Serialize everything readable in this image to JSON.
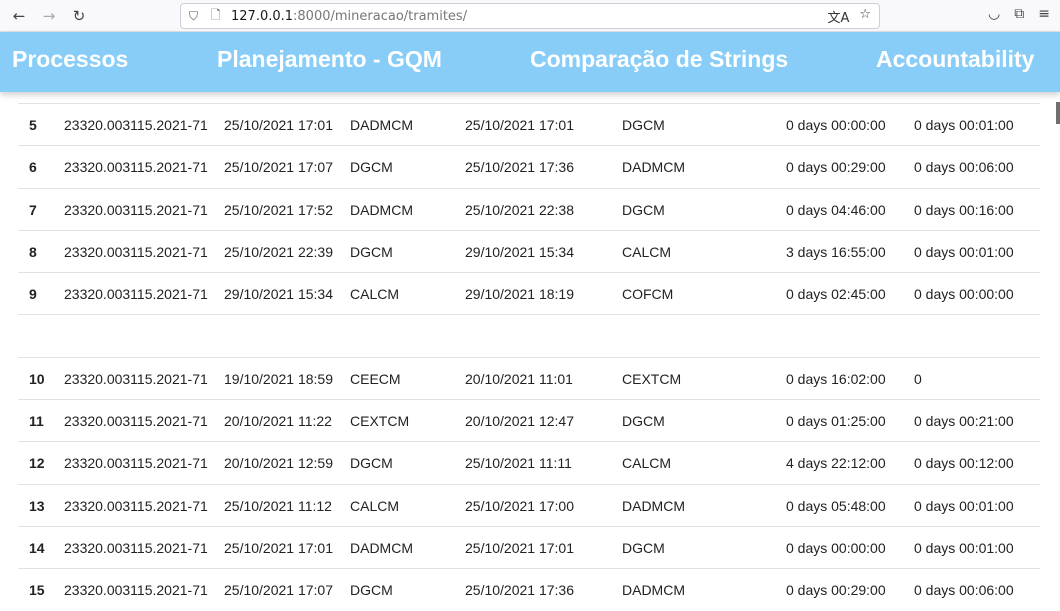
{
  "browser": {
    "back_icon": "←",
    "forward_icon": "→",
    "reload_icon": "↻",
    "url_host": "127.0.0.1",
    "url_path": ":8000/mineracao/tramites/",
    "translate_icon": "文A",
    "bookmark_icon": "☆",
    "pocket_icon": "◡",
    "extensions_icon": "⧉",
    "menu_icon": "≡"
  },
  "nav": {
    "items": [
      "Processos",
      "Planejamento - GQM",
      "Comparação de Strings",
      "Accountability"
    ]
  },
  "table": {
    "rows": [
      {
        "id": "5",
        "processo": "23320.003115.2021-71",
        "data_inicio": "25/10/2021 17:01",
        "origem": "DADMCM",
        "data_fim": "25/10/2021 17:01",
        "destino": "DGCM",
        "tempo": "0 days 00:00:00",
        "tempo2": "0 days 00:01:00"
      },
      {
        "id": "6",
        "processo": "23320.003115.2021-71",
        "data_inicio": "25/10/2021 17:07",
        "origem": "DGCM",
        "data_fim": "25/10/2021 17:36",
        "destino": "DADMCM",
        "tempo": "0 days 00:29:00",
        "tempo2": "0 days 00:06:00"
      },
      {
        "id": "7",
        "processo": "23320.003115.2021-71",
        "data_inicio": "25/10/2021 17:52",
        "origem": "DADMCM",
        "data_fim": "25/10/2021 22:38",
        "destino": "DGCM",
        "tempo": "0 days 04:46:00",
        "tempo2": "0 days 00:16:00"
      },
      {
        "id": "8",
        "processo": "23320.003115.2021-71",
        "data_inicio": "25/10/2021 22:39",
        "origem": "DGCM",
        "data_fim": "29/10/2021 15:34",
        "destino": "CALCM",
        "tempo": "3 days 16:55:00",
        "tempo2": "0 days 00:01:00"
      },
      {
        "id": "9",
        "processo": "23320.003115.2021-71",
        "data_inicio": "29/10/2021 15:34",
        "origem": "CALCM",
        "data_fim": "29/10/2021 18:19",
        "destino": "COFCM",
        "tempo": "0 days 02:45:00",
        "tempo2": "0 days 00:00:00"
      },
      {
        "blank": true
      },
      {
        "id": "10",
        "processo": "23320.003115.2021-71",
        "data_inicio": "19/10/2021 18:59",
        "origem": "CEECM",
        "data_fim": "20/10/2021 11:01",
        "destino": "CEXTCM",
        "tempo": "0 days 16:02:00",
        "tempo2": "0"
      },
      {
        "id": "11",
        "processo": "23320.003115.2021-71",
        "data_inicio": "20/10/2021 11:22",
        "origem": "CEXTCM",
        "data_fim": "20/10/2021 12:47",
        "destino": "DGCM",
        "tempo": "0 days 01:25:00",
        "tempo2": "0 days 00:21:00"
      },
      {
        "id": "12",
        "processo": "23320.003115.2021-71",
        "data_inicio": "20/10/2021 12:59",
        "origem": "DGCM",
        "data_fim": "25/10/2021 11:11",
        "destino": "CALCM",
        "tempo": "4 days 22:12:00",
        "tempo2": "0 days 00:12:00"
      },
      {
        "id": "13",
        "processo": "23320.003115.2021-71",
        "data_inicio": "25/10/2021 11:12",
        "origem": "CALCM",
        "data_fim": "25/10/2021 17:00",
        "destino": "DADMCM",
        "tempo": "0 days 05:48:00",
        "tempo2": "0 days 00:01:00"
      },
      {
        "id": "14",
        "processo": "23320.003115.2021-71",
        "data_inicio": "25/10/2021 17:01",
        "origem": "DADMCM",
        "data_fim": "25/10/2021 17:01",
        "destino": "DGCM",
        "tempo": "0 days 00:00:00",
        "tempo2": "0 days 00:01:00"
      },
      {
        "id": "15",
        "processo": "23320.003115.2021-71",
        "data_inicio": "25/10/2021 17:07",
        "origem": "DGCM",
        "data_fim": "25/10/2021 17:36",
        "destino": "DADMCM",
        "tempo": "0 days 00:29:00",
        "tempo2": "0 days 00:06:00"
      }
    ]
  }
}
